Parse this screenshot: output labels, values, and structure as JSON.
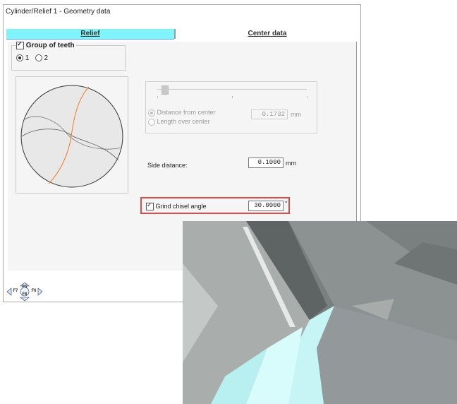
{
  "window": {
    "title": "Cylinder/Relief 1 - Geometry data"
  },
  "tabs": [
    {
      "label": "Relief",
      "active": true
    },
    {
      "label": "Center data",
      "active": false
    }
  ],
  "group_of_teeth": {
    "label": "Group of teeth",
    "checked": true,
    "options": [
      {
        "label": "1",
        "selected": true
      },
      {
        "label": "2",
        "selected": false
      }
    ]
  },
  "center_options": {
    "distance_label": "Distance from center",
    "length_label": "Length over center",
    "distance_value": "0.1732",
    "unit": "mm",
    "enabled": false
  },
  "side_distance": {
    "label": "Side distance:",
    "value": "0.1000",
    "unit": "mm"
  },
  "grind_chisel": {
    "label": "Grind chisel angle",
    "checked": true,
    "value": "30.0000",
    "unit": "°"
  },
  "footer": {
    "keys": [
      "F7",
      "F5",
      "F6",
      "F8"
    ]
  },
  "colors": {
    "active_tab": "#7ff5fb",
    "highlight": "#e34a4a",
    "curve": "#f07a2a"
  }
}
